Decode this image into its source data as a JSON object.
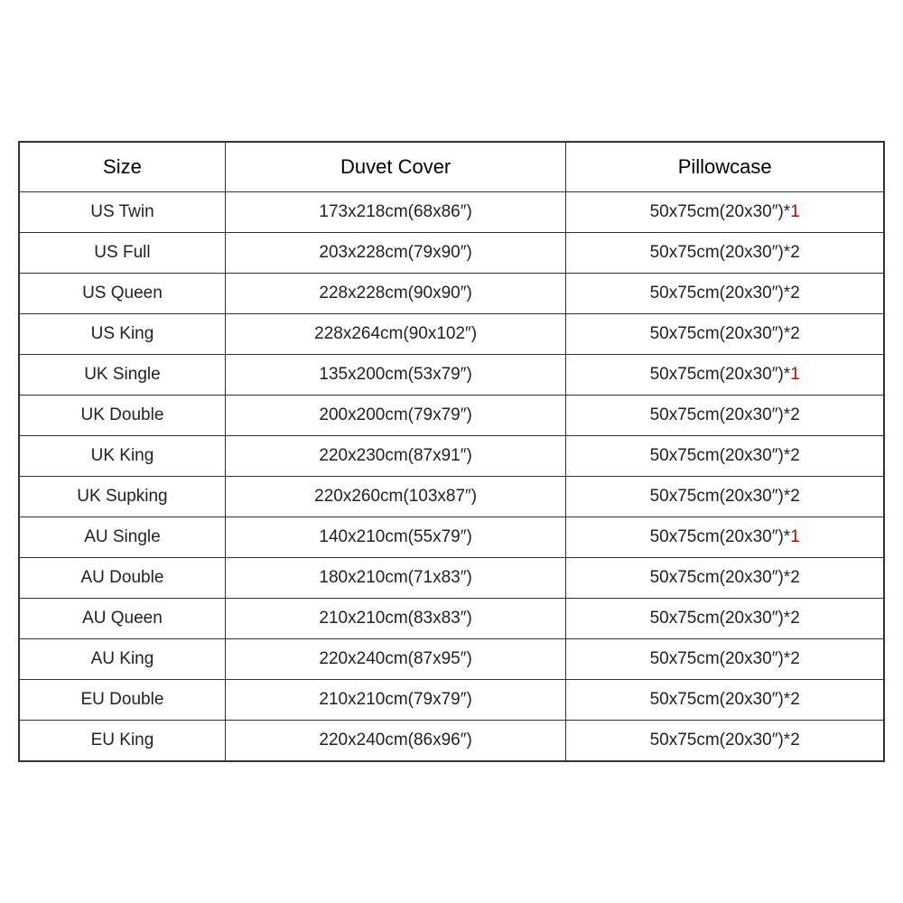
{
  "table": {
    "headers": [
      "Size",
      "Duvet Cover",
      "Pillowcase"
    ],
    "rows": [
      {
        "size": "US Twin",
        "duvet": "173x218cm(68x86″)",
        "pillow_base": "50x75cm(20x30″)*",
        "pillow_count": "1",
        "red": true
      },
      {
        "size": "US Full",
        "duvet": "203x228cm(79x90″)",
        "pillow_base": "50x75cm(20x30″)*",
        "pillow_count": "2",
        "red": false
      },
      {
        "size": "US Queen",
        "duvet": "228x228cm(90x90″)",
        "pillow_base": "50x75cm(20x30″)*",
        "pillow_count": "2",
        "red": false
      },
      {
        "size": "US King",
        "duvet": "228x264cm(90x102″)",
        "pillow_base": "50x75cm(20x30″)*",
        "pillow_count": "2",
        "red": false
      },
      {
        "size": "UK Single",
        "duvet": "135x200cm(53x79″)",
        "pillow_base": "50x75cm(20x30″)*",
        "pillow_count": "1",
        "red": true
      },
      {
        "size": "UK Double",
        "duvet": "200x200cm(79x79″)",
        "pillow_base": "50x75cm(20x30″)*",
        "pillow_count": "2",
        "red": false
      },
      {
        "size": "UK King",
        "duvet": "220x230cm(87x91″)",
        "pillow_base": "50x75cm(20x30″)*",
        "pillow_count": "2",
        "red": false
      },
      {
        "size": "UK Supking",
        "duvet": "220x260cm(103x87″)",
        "pillow_base": "50x75cm(20x30″)*",
        "pillow_count": "2",
        "red": false
      },
      {
        "size": "AU Single",
        "duvet": "140x210cm(55x79″)",
        "pillow_base": "50x75cm(20x30″)*",
        "pillow_count": "1",
        "red": true
      },
      {
        "size": "AU Double",
        "duvet": "180x210cm(71x83″)",
        "pillow_base": "50x75cm(20x30″)*",
        "pillow_count": "2",
        "red": false
      },
      {
        "size": "AU Queen",
        "duvet": "210x210cm(83x83″)",
        "pillow_base": "50x75cm(20x30″)*",
        "pillow_count": "2",
        "red": false
      },
      {
        "size": "AU King",
        "duvet": "220x240cm(87x95″)",
        "pillow_base": "50x75cm(20x30″)*",
        "pillow_count": "2",
        "red": false
      },
      {
        "size": "EU Double",
        "duvet": "210x210cm(79x79″)",
        "pillow_base": "50x75cm(20x30″)*",
        "pillow_count": "2",
        "red": false
      },
      {
        "size": "EU King",
        "duvet": "220x240cm(86x96″)",
        "pillow_base": "50x75cm(20x30″)*",
        "pillow_count": "2",
        "red": false
      }
    ]
  }
}
